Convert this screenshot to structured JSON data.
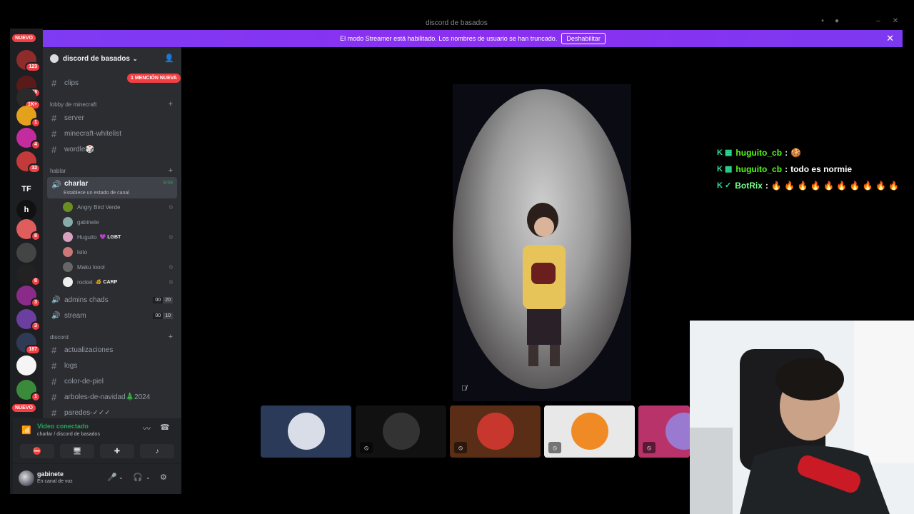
{
  "window": {
    "title": "discord de basados"
  },
  "banner": {
    "message": "El modo Streamer está habilitado. Los nombres de usuario se han truncado.",
    "button": "Deshabilitar"
  },
  "rail": {
    "top_pill": "NUEVO",
    "bottom_pill": "NUEVO",
    "servers": [
      {
        "badge": "123",
        "color": "#8e2b2b"
      },
      {
        "badge": "298",
        "color": "#5b1a1a"
      },
      {
        "badge": "1K+",
        "color": "#2a2a2a"
      },
      {
        "badge": "1",
        "color": "#e4a11b"
      },
      {
        "badge": "4",
        "color": "#c32c9f"
      },
      {
        "badge": "32",
        "color": "#c23a3a"
      },
      {
        "badge": "",
        "label": "TF",
        "color": "#1e1f22"
      },
      {
        "badge": "",
        "label": "h",
        "color": "#111111"
      },
      {
        "badge": "8",
        "color": "#e05d5d"
      },
      {
        "badge": "",
        "color": "#444444"
      },
      {
        "badge": "8",
        "color": "#222222"
      },
      {
        "badge": "3",
        "color": "#8a2b8a"
      },
      {
        "badge": "3",
        "color": "#6b3fa0"
      },
      {
        "badge": "187",
        "color": "#2f3b55"
      },
      {
        "badge": "",
        "color": "#f5f5f5"
      },
      {
        "badge": "1",
        "color": "#3b8a3b"
      }
    ]
  },
  "sidebar": {
    "guild_name": "discord de basados",
    "mention_pill": "1 MENCIÓN NUEVA",
    "clips": "clips",
    "cat_minecraft": "lobby de minecraft",
    "server": "server",
    "whitelist": "minecraft-whitelist",
    "wordle": "wordle🎲",
    "cat_hablar": "hablar",
    "charlar": "charlar",
    "charlar_time": "9:59",
    "charlar_status": "Establece un estado de canal",
    "voice_users": [
      {
        "name": "Angry Bird Verde",
        "tag": ""
      },
      {
        "name": "gabinete",
        "tag": ""
      },
      {
        "name": "Huguito",
        "tag": "💜 LGBT"
      },
      {
        "name": "lsito",
        "tag": ""
      },
      {
        "name": "Maku loool",
        "tag": ""
      },
      {
        "name": "rocket",
        "tag": "🐠 CARP"
      }
    ],
    "admins": "admins chads",
    "admins_count": [
      "00",
      "20"
    ],
    "stream": "stream",
    "stream_count": [
      "00",
      "10"
    ],
    "cat_discord": "discord",
    "actualizaciones": "actualizaciones",
    "logs": "logs",
    "color": "color-de-piel",
    "arboles": "arboles-de-navidad🎄2024",
    "paredes": "paredes-✓✓✓"
  },
  "voice_panel": {
    "status": "Video conectado",
    "location": "charlar / discord de basados"
  },
  "user_panel": {
    "name": "gabinete",
    "status": "En canal de voz"
  },
  "chat": [
    {
      "user": "huguito_cb",
      "sep": ":",
      "message": "🍪"
    },
    {
      "user": "huguito_cb",
      "sep": ":",
      "message": "todo es normie"
    },
    {
      "user": "BotRix",
      "sep": ":",
      "message": "🔥 🔥 🔥 🔥 🔥 🔥 🔥 🔥 🔥 🔥"
    }
  ],
  "tiles": [
    {
      "color": "#2a3a58"
    },
    {
      "color": "#111111"
    },
    {
      "color": "#5a2e16"
    },
    {
      "color": "#e8e8e8"
    },
    {
      "color": "#b8336a"
    }
  ],
  "colors": {
    "accent": "#5865f2",
    "banner": "#8b2ff0",
    "green": "#23a55a",
    "red": "#f23f43",
    "kick": "#53fc18"
  }
}
